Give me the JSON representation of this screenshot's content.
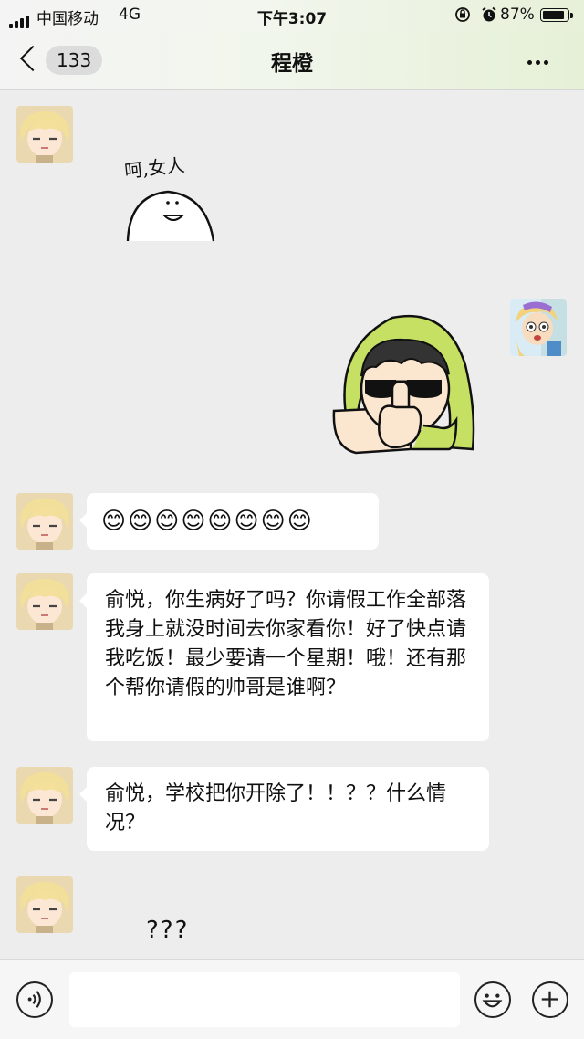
{
  "status_bar": {
    "carrier": "中国移动",
    "network": "4G",
    "time": "下午3:07",
    "battery_percent": "87%",
    "battery_level": 0.87
  },
  "nav": {
    "unread_count": "133",
    "title": "程橙"
  },
  "messages": {
    "sticker1_text": "呵,女人",
    "emoji_row": "😊😊😊😊😊😊😊😊",
    "msg1": "俞悦，你生病好了吗？你请假工作全部落我身上就没时间去你家看你！好了快点请我吃饭！最少要请一个星期！哦！还有那个帮你请假的帅哥是谁啊？",
    "msg2": "俞悦，学校把你开除了！！？？什么情况？",
    "msg3": "???"
  }
}
